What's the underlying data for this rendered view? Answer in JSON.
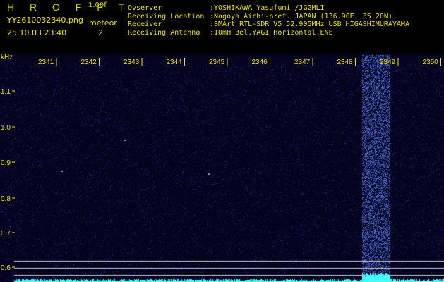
{
  "header": {
    "app_name": "H R O F F T",
    "version": "1.00f",
    "filename": "YY2610032340.png",
    "datetime": "25.10.03 23:40",
    "meteor_label": "meteor",
    "meteor_count": "2"
  },
  "station": [
    {
      "key": "Ovserver",
      "value": ":YOSHIKAWA Yasufumi /JG2MLI"
    },
    {
      "key": "Receiving Location",
      "value": ":Nagoya Aichi-pref. JAPAN (136.90E, 35.20N)"
    },
    {
      "key": "Receiver",
      "value": ":SMArt RTL-SDR V5 52.905MHz USB HIGASHIMURAYAMA"
    },
    {
      "key": "Receiving Antenna",
      "value": ":10mH 3el.YAGI Horizontal:ENE"
    }
  ],
  "plot": {
    "y_unit": "kHz",
    "x_ticks": [
      "2341",
      "2342",
      "2343",
      "2344",
      "2345",
      "2346",
      "2347",
      "2348",
      "2349",
      "2350"
    ],
    "y_ticks": [
      "1.1",
      "1.0",
      "0.9",
      "0.8",
      "0.7",
      "0.6"
    ],
    "colors": {
      "background": "#04041e",
      "noise": "#1a1ad8",
      "burst": "#2040ff",
      "text": "#f0e000",
      "trace": "#40ffff"
    }
  }
}
